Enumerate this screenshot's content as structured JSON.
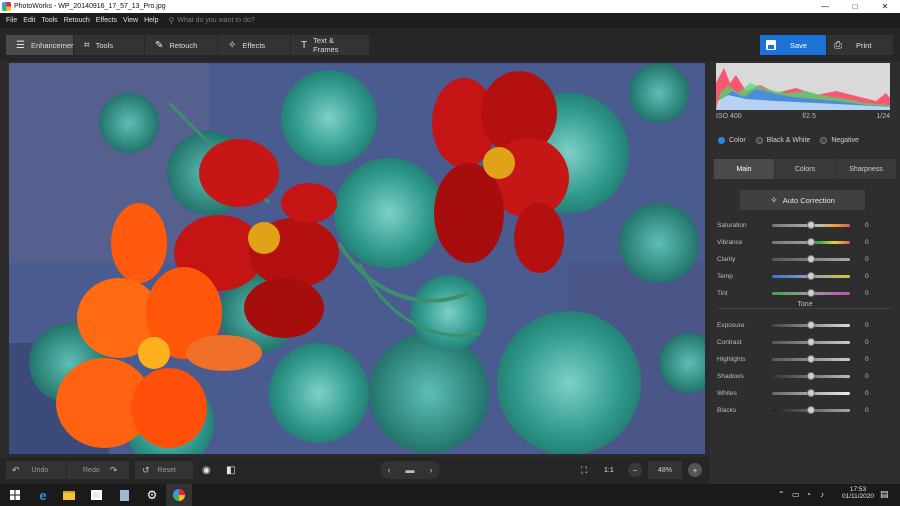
{
  "window": {
    "title": "PhotoWorks - WP_20140916_17_57_13_Pro.jpg",
    "controls": {
      "minimize": "—",
      "maximize": "□",
      "close": "✕"
    }
  },
  "menu": {
    "items": [
      "File",
      "Edit",
      "Tools",
      "Retouch",
      "Effects",
      "View",
      "Help"
    ],
    "search_placeholder": "What do you want to do?"
  },
  "toolbar": {
    "tabs": [
      {
        "label": "Enhancement",
        "icon": "sliders-icon",
        "glyph": "☰"
      },
      {
        "label": "Tools",
        "icon": "crop-icon",
        "glyph": "⌗"
      },
      {
        "label": "Retouch",
        "icon": "brush-icon",
        "glyph": "✎"
      },
      {
        "label": "Effects",
        "icon": "magic-wand-icon",
        "glyph": "✧"
      },
      {
        "label": "Text & Frames",
        "icon": "text-icon",
        "glyph": "T"
      }
    ],
    "save_label": "Save",
    "print_label": "Print"
  },
  "histogram": {
    "iso": "ISO 400",
    "aperture": "f/2.5",
    "shutter": "1/24"
  },
  "color_modes": {
    "options": [
      "Color",
      "Black & White",
      "Negative"
    ],
    "selected": "Color"
  },
  "panel_tabs": [
    "Main",
    "Colors",
    "Sharpness"
  ],
  "auto_correction_label": "Auto Correction",
  "sliders_main": [
    {
      "label": "Saturation",
      "value": "0",
      "track": "linear-gradient(90deg,#777,#bbb 60%,#e6a23c,#e05a5a)"
    },
    {
      "label": "Vibrance",
      "value": "0",
      "track": "linear-gradient(90deg,#777,#999 40%,#3fa34d,#e6d23c,#e05a5a)"
    },
    {
      "label": "Clarity",
      "value": "0",
      "track": "linear-gradient(90deg,#555,#aaa)"
    },
    {
      "label": "Temp",
      "value": "0",
      "track": "linear-gradient(90deg,#3d6fe0,#8fa0c0 50%,#e0c23c)"
    },
    {
      "label": "Tint",
      "value": "0",
      "track": "linear-gradient(90deg,#3fa34d,#9a9a9a 50%,#c04cc0)"
    }
  ],
  "tone_heading": "Tone",
  "sliders_tone": [
    {
      "label": "Exposure",
      "value": "0",
      "track": "linear-gradient(90deg,#444,#ddd)"
    },
    {
      "label": "Contrast",
      "value": "0",
      "track": "linear-gradient(90deg,#555,#ccc)"
    },
    {
      "label": "Highlights",
      "value": "0",
      "track": "linear-gradient(90deg,#555,#ccc)"
    },
    {
      "label": "Shadows",
      "value": "0",
      "track": "linear-gradient(90deg,#333,#bbb)"
    },
    {
      "label": "Whites",
      "value": "0",
      "track": "linear-gradient(90deg,#666,#eee)"
    },
    {
      "label": "Blacks",
      "value": "0",
      "track": "linear-gradient(90deg,#222,#aaa)"
    }
  ],
  "bottom": {
    "undo_label": "Undo",
    "redo_label": "Redo",
    "reset_label": "Reset",
    "actual_size_label": "1:1",
    "zoom_value": "48%"
  },
  "taskbar": {
    "time": "17:53",
    "date": "01/11/2020"
  },
  "colors": {
    "accent": "#1e74d6",
    "panel": "#2e2e2e",
    "toolbar": "#262626"
  }
}
